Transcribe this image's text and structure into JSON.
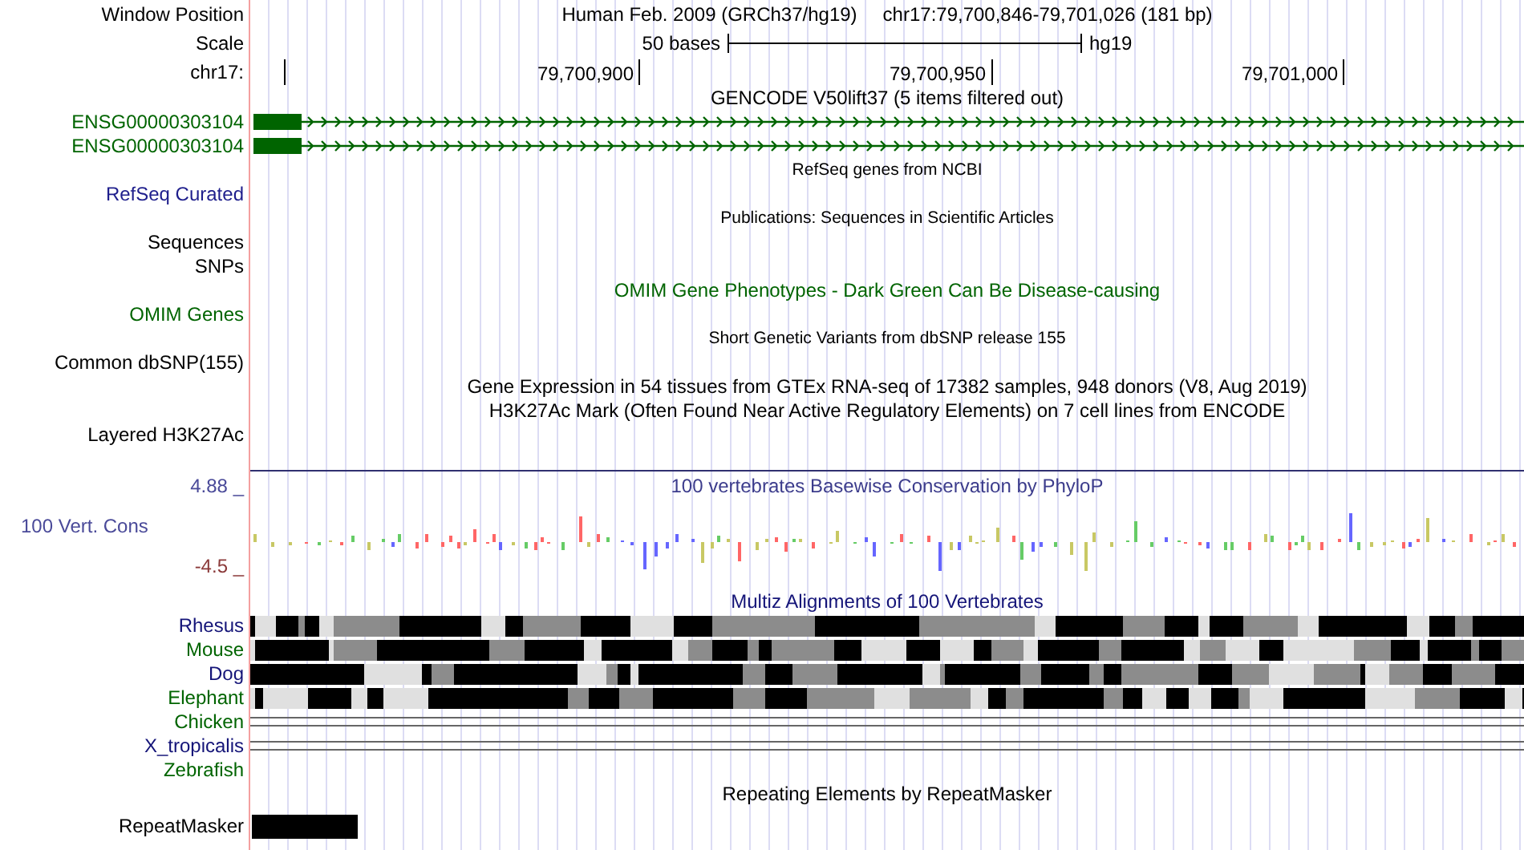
{
  "header": {
    "window_label": "Window Position",
    "assembly": "Human Feb. 2009 (GRCh37/hg19)",
    "position": "chr17:79,700,846-79,701,026 (181 bp)",
    "scale_label": "Scale",
    "scale_text": "50 bases",
    "scale_db": "hg19",
    "chrom_label": "chr17:",
    "ruler_ticks": [
      "79,700,900",
      "79,700,950",
      "79,701,000"
    ]
  },
  "tracks": [
    {
      "kind": "gene",
      "title": "GENCODE V50lift37 (5 items filtered out)",
      "color": "#000000",
      "small": false,
      "labels": [
        {
          "text": "ENSG00000303104",
          "color": "#006400"
        },
        {
          "text": "ENSG00000303104",
          "color": "#006400"
        }
      ]
    },
    {
      "kind": "empty",
      "title": "RefSeq genes from NCBI",
      "color": "#000000",
      "small": true,
      "labels": [
        {
          "text": "RefSeq Curated",
          "color": "#1e1e8c"
        }
      ]
    },
    {
      "kind": "empty",
      "title": "Publications: Sequences in Scientific Articles",
      "color": "#000000",
      "small": true,
      "labels": [
        {
          "text": "Sequences",
          "color": "#000000"
        },
        {
          "text": "SNPs",
          "color": "#000000"
        }
      ]
    },
    {
      "kind": "empty",
      "title": "OMIM Gene Phenotypes - Dark Green Can Be Disease-causing",
      "color": "#006400",
      "small": false,
      "labels": [
        {
          "text": "OMIM Genes",
          "color": "#006400"
        }
      ]
    },
    {
      "kind": "empty",
      "title": "Short Genetic Variants from dbSNP release 155",
      "color": "#000000",
      "small": true,
      "labels": [
        {
          "text": "Common dbSNP(155)",
          "color": "#000000"
        }
      ]
    },
    {
      "kind": "empty",
      "title": "Gene Expression in 54 tissues from GTEx RNA-seq of 17382 samples, 948 donors (V8, Aug 2019)",
      "color": "#000000",
      "small": false
    },
    {
      "kind": "empty",
      "title": "H3K27Ac Mark (Often Found Near Active Regulatory Elements) on 7 cell lines from ENCODE",
      "color": "#000000",
      "small": false,
      "labels": [
        {
          "text": "Layered H3K27Ac",
          "color": "#000000"
        }
      ]
    },
    {
      "kind": "wiggle",
      "title": "100 vertebrates Basewise Conservation by PhyloP",
      "color": "#3c3c8c",
      "small": false,
      "labels": [
        {
          "text": "100 Vert. Cons",
          "color": "#4a4a99"
        }
      ],
      "max": "4.88 _",
      "min": "-4.5 _"
    },
    {
      "kind": "alignment",
      "title": "Multiz Alignments of 100 Vertebrates",
      "color": "#141478",
      "small": false,
      "labels": [
        {
          "text": "Rhesus",
          "color": "#141478",
          "kind": "blocks"
        },
        {
          "text": "Mouse",
          "color": "#006400",
          "kind": "blocks"
        },
        {
          "text": "Dog",
          "color": "#141478",
          "kind": "blocks"
        },
        {
          "text": "Elephant",
          "color": "#006400",
          "kind": "blocks"
        },
        {
          "text": "Chicken",
          "color": "#006400",
          "kind": "lines"
        },
        {
          "text": "X_tropicalis",
          "color": "#141478",
          "kind": "lines"
        },
        {
          "text": "Zebrafish",
          "color": "#006400",
          "kind": "none"
        }
      ]
    },
    {
      "kind": "repeat",
      "title": "Repeating Elements by RepeatMasker",
      "color": "#000000",
      "small": false,
      "labels": [
        {
          "text": "RepeatMasker",
          "color": "#000000"
        }
      ]
    }
  ]
}
